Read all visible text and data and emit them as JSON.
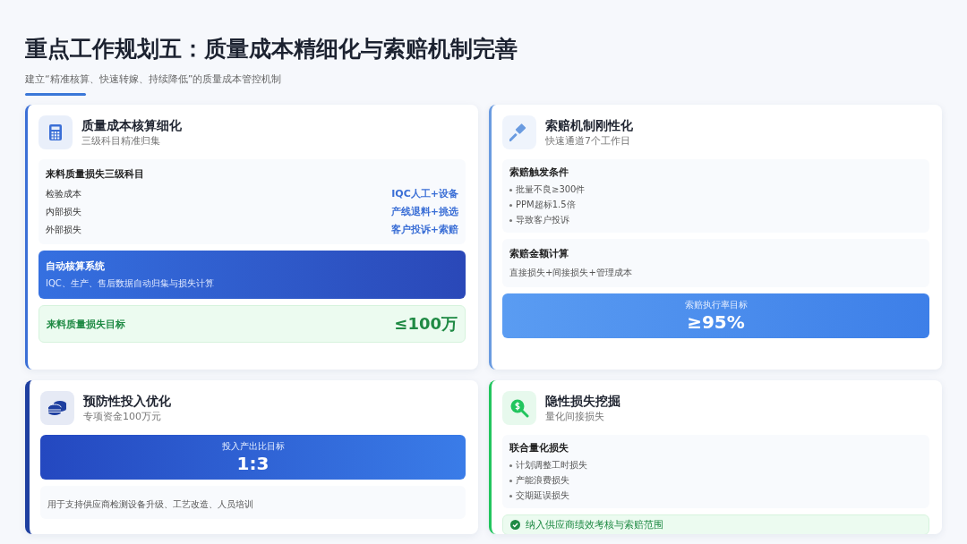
{
  "title": "重点工作规划五：质量成本精细化与索赔机制完善",
  "subtitle": "建立“精准核算、快速转嫁、持续降低”的质量成本管控机制",
  "cards": [
    {
      "title": "质量成本核算细化",
      "subtitle": "三级科目精准归集",
      "color": "#3b6fd6",
      "blocks": [
        {
          "kind": "table",
          "title": "来料质量损失三级科目",
          "rows": [
            {
              "label": "检验成本",
              "value": "IQC人工+设备"
            },
            {
              "label": "内部损失",
              "value": "产线退料+挑选"
            },
            {
              "label": "外部损失",
              "value": "客户投诉+索赔"
            }
          ]
        },
        {
          "kind": "banner",
          "title": "自动核算系统",
          "text": "IQC、生产、售后数据自动归集与损失计算"
        },
        {
          "kind": "target",
          "label": "来料质量损失目标",
          "value": "≤100万"
        }
      ]
    },
    {
      "title": "索赔机制刚性化",
      "subtitle": "快速通道7个工作日",
      "color": "#6a9be0",
      "blocks": [
        {
          "kind": "list",
          "title": "索赔触发条件",
          "items": [
            "批量不良≥300件",
            "PPM超标1.5倍",
            "导致客户投诉"
          ]
        },
        {
          "kind": "formula",
          "title": "索赔金额计算",
          "text": "直接损失+间接损失+管理成本"
        },
        {
          "kind": "metric",
          "label": "索赔执行率目标",
          "value": "≥95%"
        }
      ]
    },
    {
      "title": "预防性投入优化",
      "subtitle": "专项资金100万元",
      "color": "#1e3fa0",
      "blocks": [
        {
          "kind": "metric",
          "label": "投入产出比目标",
          "value": "1:3"
        },
        {
          "kind": "note",
          "text": "用于支持供应商检测设备升级、工艺改造、人员培训"
        }
      ]
    },
    {
      "title": "隐性损失挖掘",
      "subtitle": "量化间接损失",
      "color": "#22c55e",
      "blocks": [
        {
          "kind": "list",
          "title": "联合量化损失",
          "items": [
            "计划调整工时损失",
            "产能浪费损失",
            "交期延误损失"
          ]
        },
        {
          "kind": "check",
          "text": "纳入供应商绩效考核与索赔范围"
        }
      ]
    }
  ]
}
